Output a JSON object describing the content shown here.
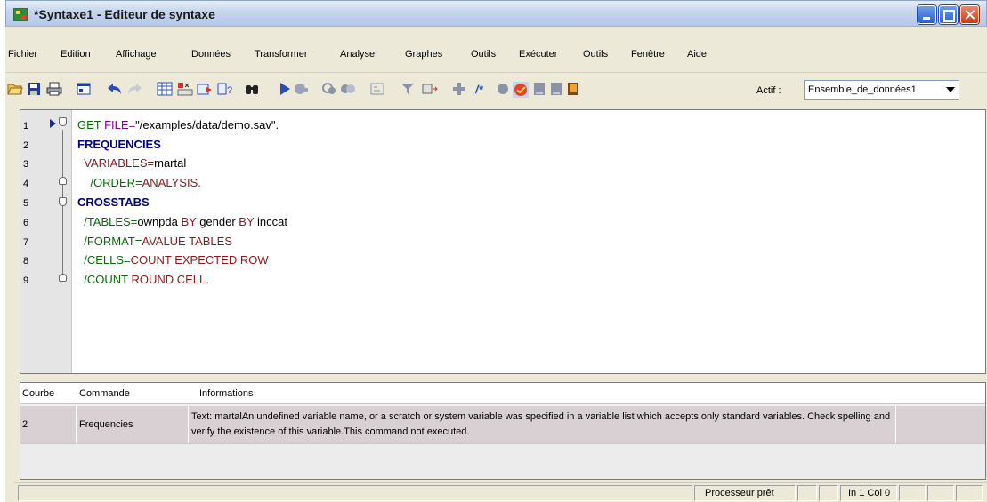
{
  "window": {
    "title": "*Syntaxe1 - Editeur de syntaxe"
  },
  "menu": [
    {
      "label": "Fichier"
    },
    {
      "label": "Edition"
    },
    {
      "label": "Affichage"
    },
    {
      "label": "Données"
    },
    {
      "label": "Transformer"
    },
    {
      "label": "Analyse"
    },
    {
      "label": "Graphes"
    },
    {
      "label": "Outils"
    },
    {
      "label": "Exécuter"
    },
    {
      "label": "Outils"
    },
    {
      "label": "Fenêtre"
    },
    {
      "label": "Aide"
    }
  ],
  "toolbar": {
    "actif_label": "Actif :",
    "dataset_value": "Ensemble_de_données1",
    "icons": [
      "open-icon",
      "save-icon",
      "print-icon",
      "recall-dialog-icon",
      "undo-icon",
      "redo-icon",
      "goto-data-icon",
      "variables-icon",
      "insert-icon",
      "value-labels-icon",
      "find-icon",
      "run-icon",
      "stop-icon",
      "syntax-help-icon",
      "toggle-icon",
      "show-icon",
      "comment-icon",
      "breakpoint-icon",
      "bookmark-icon",
      "book-icon",
      "book2-icon",
      "book3-icon"
    ]
  },
  "editor": {
    "line_numbers": [
      "1",
      "2",
      "3",
      "4",
      "5",
      "6",
      "7",
      "8",
      "9"
    ],
    "lines": [
      [
        {
          "t": "GET ",
          "c": "sub"
        },
        {
          "t": "FILE=",
          "c": "eqk"
        },
        {
          "t": "\"/examples/data/demo.sav\".",
          "c": "str"
        }
      ],
      [
        {
          "t": "FREQUENCIES",
          "c": "kw"
        }
      ],
      [
        {
          "t": "  VARIABLES=",
          "c": "kwv"
        },
        {
          "t": "martal",
          "c": "val"
        }
      ],
      [
        {
          "t": "    /ORDER=",
          "c": "sub"
        },
        {
          "t": "ANALYSIS.",
          "c": "kwv"
        }
      ],
      [
        {
          "t": "CROSSTABS",
          "c": "kw"
        }
      ],
      [
        {
          "t": "  /TABLES=",
          "c": "sub"
        },
        {
          "t": "ownpda ",
          "c": "val"
        },
        {
          "t": "BY ",
          "c": "kwv"
        },
        {
          "t": "gender ",
          "c": "val"
        },
        {
          "t": "BY ",
          "c": "kwv"
        },
        {
          "t": "inccat",
          "c": "val"
        }
      ],
      [
        {
          "t": "  /FORMAT=",
          "c": "sub"
        },
        {
          "t": "AVALUE TABLES",
          "c": "kwv"
        }
      ],
      [
        {
          "t": "  /CELLS=",
          "c": "sub"
        },
        {
          "t": "COUNT EXPECTED ROW",
          "c": "kwv"
        }
      ],
      [
        {
          "t": "  /COUNT ",
          "c": "sub"
        },
        {
          "t": "ROUND CELL.",
          "c": "kwv"
        }
      ]
    ]
  },
  "panel": {
    "headers": {
      "line": "Courbe",
      "command": "Commande",
      "info": "Informations"
    },
    "rows": [
      {
        "line": "2",
        "command": "Frequencies",
        "info": "Text: martalAn undefined variable name, or a scratch or system variable was specified in a variable list which accepts only standard variables.  Check spelling and verify the existence of this variable.This command not executed."
      }
    ]
  },
  "status": {
    "processor": "Processeur prêt",
    "cursor": "In 1 Col 0"
  }
}
